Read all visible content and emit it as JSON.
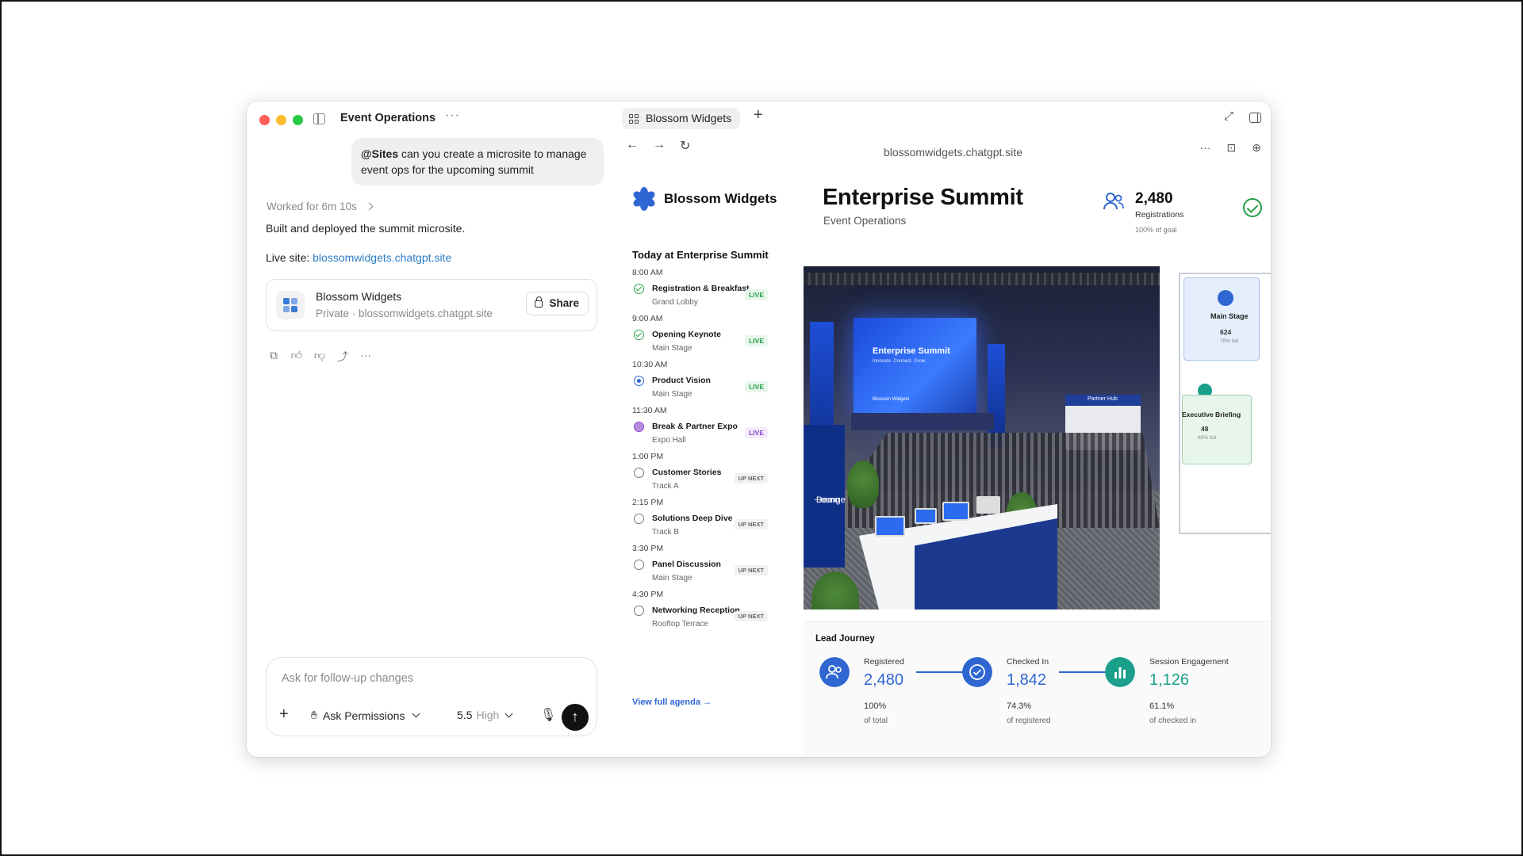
{
  "chat": {
    "title": "Event Operations",
    "user_message_mention": "@Sites",
    "user_message_text": " can you create a microsite to manage event ops for the upcoming summit",
    "worked_for": "Worked for 6m 10s",
    "response": "Built and deployed the summit microsite.",
    "live_site_label": "Live site: ",
    "live_site_link": "blossomwidgets.chatgpt.site",
    "card": {
      "name": "Blossom Widgets",
      "subtitle": "Private · blossomwidgets.chatgpt.site",
      "share_label": "Share"
    },
    "composer": {
      "placeholder": "Ask for follow-up changes",
      "permissions_label": "Ask Permissions",
      "model": "5.5",
      "effort": "High"
    }
  },
  "browser": {
    "tab_title": "Blossom Widgets",
    "url": "blossomwidgets.chatgpt.site"
  },
  "site": {
    "brand": "Blossom Widgets",
    "title": "Enterprise Summit",
    "subtitle": "Event Operations",
    "registrations": {
      "value": "2,480",
      "label": "Registrations",
      "goal": "100% of goal"
    },
    "agenda_title": "Today at Enterprise Summit",
    "agenda": [
      {
        "time": "8:00 AM",
        "name": "Registration & Breakfast",
        "location": "Grand Lobby",
        "status": "LIVE",
        "state": "done"
      },
      {
        "time": "9:00 AM",
        "name": "Opening Keynote",
        "location": "Main Stage",
        "status": "LIVE",
        "state": "done"
      },
      {
        "time": "10:30 AM",
        "name": "Product Vision",
        "location": "Main Stage",
        "status": "LIVE",
        "state": "current"
      },
      {
        "time": "11:30 AM",
        "name": "Break & Partner Expo",
        "location": "Expo Hall",
        "status": "LIVE",
        "state": "break"
      },
      {
        "time": "1:00 PM",
        "name": "Customer Stories",
        "location": "Track A",
        "status": "UP NEXT",
        "state": "upcoming"
      },
      {
        "time": "2:15 PM",
        "name": "Solutions Deep Dive",
        "location": "Track B",
        "status": "UP NEXT",
        "state": "upcoming"
      },
      {
        "time": "3:30 PM",
        "name": "Panel Discussion",
        "location": "Main Stage",
        "status": "UP NEXT",
        "state": "upcoming"
      },
      {
        "time": "4:30 PM",
        "name": "Networking Reception",
        "location": "Rooftop Terrace",
        "status": "UP NEXT",
        "state": "upcoming"
      }
    ],
    "view_agenda": "View full agenda →",
    "photo": {
      "screen_title": "Enterprise Summit",
      "screen_sub": "Innovate. Connect. Grow.",
      "screen_brand": "Blossom Widgets",
      "partner_hub": "Partner Hub",
      "demo_lounge_1": "Demo",
      "demo_lounge_2": "Lounge"
    },
    "floor_plan": {
      "main_stage": {
        "label": "Main Stage",
        "count": "624",
        "capacity": "78% full"
      },
      "exec": {
        "label": "Executive Briefing",
        "count": "48",
        "capacity": "80% full"
      }
    },
    "journey": {
      "title": "Lead Journey",
      "steps": [
        {
          "label": "Registered",
          "value": "2,480",
          "pct": "100%",
          "of": "of total",
          "color": "#2f66d1"
        },
        {
          "label": "Checked In",
          "value": "1,842",
          "pct": "74.3%",
          "of": "of registered",
          "color": "#2f66d1"
        },
        {
          "label": "Session Engagement",
          "value": "1,126",
          "pct": "61.1%",
          "of": "of checked in",
          "color": "#1aa08a"
        }
      ]
    }
  },
  "colors": {
    "accent": "#2f66d1",
    "live": "#24a148",
    "purple": "#8b48c9",
    "teal": "#1aa08a"
  }
}
